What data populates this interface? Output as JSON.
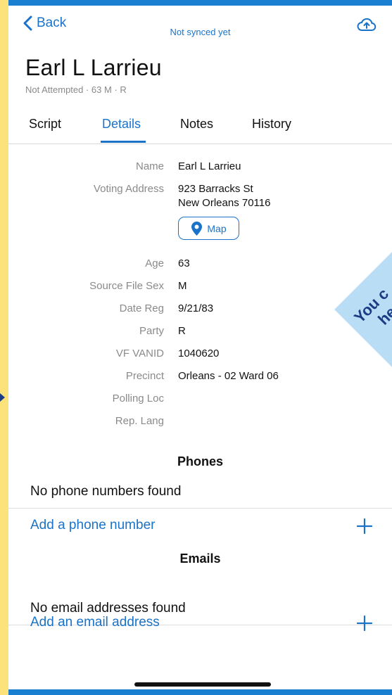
{
  "header": {
    "back_label": "Back",
    "sync_status": "Not synced yet",
    "upload_icon": "cloud-upload-icon"
  },
  "contact": {
    "name": "Earl L Larrieu",
    "summary": "Not Attempted · 63 M · R"
  },
  "tabs": [
    {
      "label": "Script",
      "active": false
    },
    {
      "label": "Details",
      "active": true
    },
    {
      "label": "Notes",
      "active": false
    },
    {
      "label": "History",
      "active": false
    }
  ],
  "details": {
    "name_label": "Name",
    "name_value": "Earl L Larrieu",
    "address_label": "Voting Address",
    "address_line1": "923 Barracks St",
    "address_line2": "New Orleans 70116",
    "map_button": "Map",
    "age_label": "Age",
    "age_value": "63",
    "sex_label": "Source File Sex",
    "sex_value": "M",
    "date_reg_label": "Date Reg",
    "date_reg_value": "9/21/83",
    "party_label": "Party",
    "party_value": "R",
    "vanid_label": "VF VANID",
    "vanid_value": "1040620",
    "precinct_label": "Precinct",
    "precinct_value": "Orleans - 02 Ward 06",
    "polling_label": "Polling Loc",
    "lang_label": "Rep. Lang"
  },
  "phones": {
    "title": "Phones",
    "empty": "No phone numbers found",
    "add_label": "Add a phone number"
  },
  "emails": {
    "title": "Emails",
    "empty": "No email addresses found",
    "add_label": "Add an email address"
  },
  "overlay": {
    "banner_line1": "You c",
    "banner_line2": "he"
  },
  "colors": {
    "accent": "#1a73c9",
    "frame": "#1a7fd0",
    "backdrop": "#fbe27a",
    "banner": "#b9ddf4"
  }
}
